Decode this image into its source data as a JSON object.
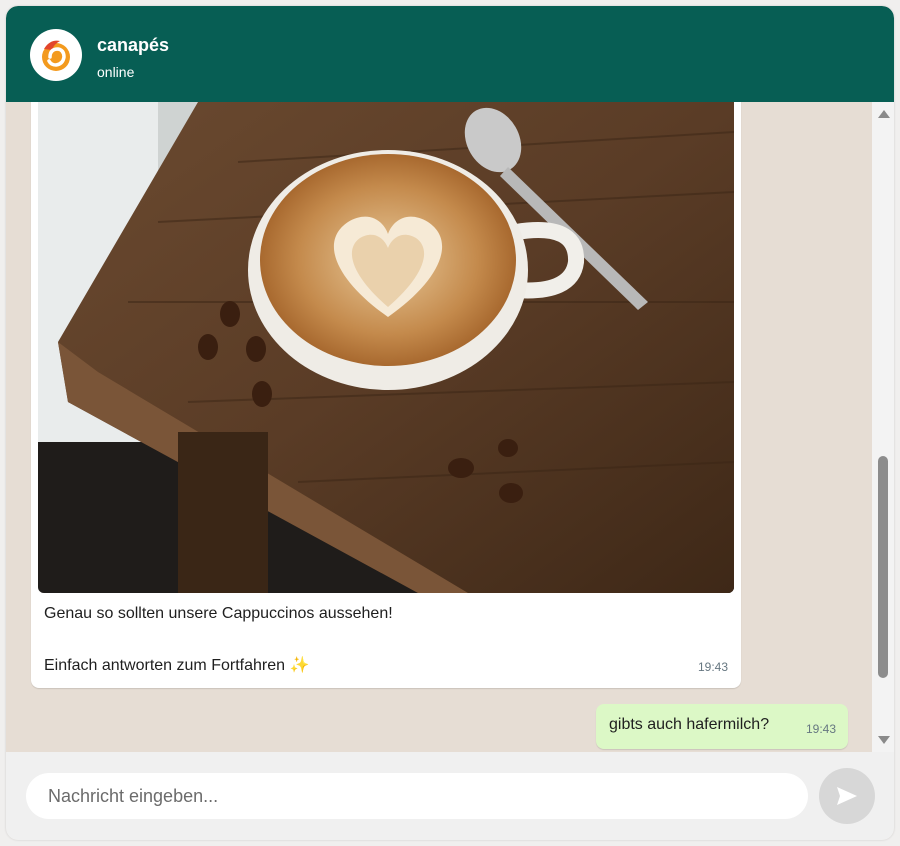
{
  "header": {
    "title": "canapés",
    "status": "online"
  },
  "messages": [
    {
      "direction": "incoming",
      "image": "latte-art-cappuccino-photo",
      "line1": "Genau so sollten unsere Cappuccinos aussehen!",
      "line2": "Einfach antworten zum Fortfahren",
      "emoji": "✨",
      "time": "19:43"
    },
    {
      "direction": "outgoing",
      "text": "gibts auch hafermilch?",
      "time": "19:43"
    }
  ],
  "composer": {
    "placeholder": "Nachricht eingeben...",
    "send_icon": "send-icon"
  },
  "colors": {
    "header": "#075e54",
    "chat_background": "#e6ddd4",
    "outgoing_bubble": "#dcf8c6",
    "incoming_bubble": "#ffffff"
  }
}
